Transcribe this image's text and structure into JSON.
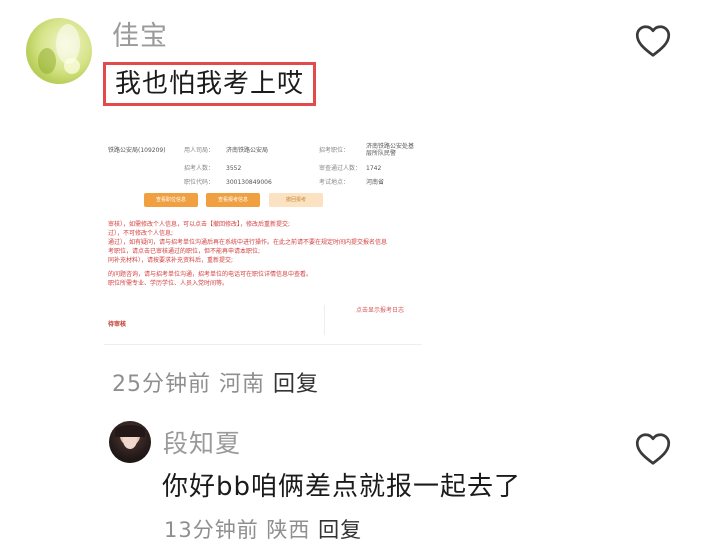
{
  "comment": {
    "user": "佳宝",
    "text": "我也怕我考上哎",
    "time": "25分钟前",
    "location": "河南",
    "reply_label": "回复"
  },
  "embedded_image": {
    "rows": [
      [
        "铁路公安局(109209)",
        "用人司局：",
        "济南铁路公安局",
        "招考职位：",
        "济南铁路公安处基层所队民警"
      ],
      [
        "",
        "招考人数：",
        "3552",
        "审查通过人数：",
        "1742"
      ],
      [
        "",
        "职位代码：",
        "300130849006",
        "考试地点：",
        "河南省"
      ]
    ],
    "buttons": [
      "查看职位信息",
      "查看报考信息",
      "撤回报考"
    ],
    "notes": [
      "审核），如需修改个人信息，可以点击【撤回修改】，修改后重新提交;",
      "过），不可修改个人信息;",
      "通过），如有疑问，请与招考单位沟通后再在系统中进行操作。在此之前请不要在规定时间内提交报名信息",
      "考职位，请点击已审核通过的职位，但不能再申请本职位;",
      "同补充材料），请按要求补充资料后，重新提交;",
      "的问题咨询，请与招考单位沟通，招考单位的电话可在职位详情信息中查看。",
      "职位所需专业、学历学位、人员入党时间等。"
    ],
    "status": "待审核",
    "link": "点击显示报考日志"
  },
  "reply": {
    "user": "段知夏",
    "text": "你好bb咱俩差点就报一起去了",
    "time": "13分钟前",
    "location": "陕西",
    "reply_label": "回复"
  },
  "colors": {
    "highlight_border": "#e14b4b",
    "meta_gray": "#8f8f8f",
    "name_gray": "#9a9a9a",
    "button_orange": "#f0a040"
  },
  "icons": [
    "heart-outline-icon"
  ]
}
